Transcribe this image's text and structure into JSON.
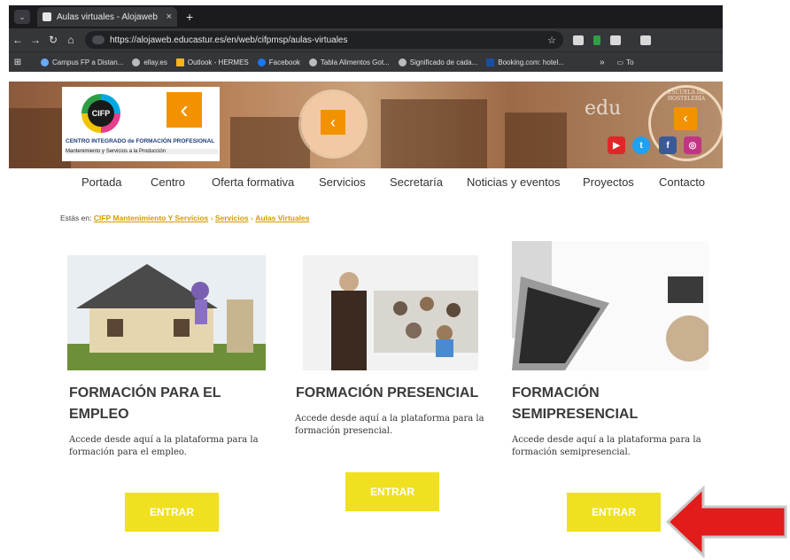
{
  "browser": {
    "tab_title": "Aulas virtuales - Alojaweb",
    "tab_close": "×",
    "new_tab": "+",
    "url": "https://alojaweb.educastur.es/en/web/cifpmsp/aulas-virtuales",
    "bookmarks": [
      "Campus FP a Distan...",
      "ellay.es",
      "Outlook - HERMES",
      "Facebook",
      "Tabla Alimentos Got...",
      "Significado de cada...",
      "Booking.com: hotel..."
    ],
    "bookmarks_more": "»",
    "bookmarks_folder": "To"
  },
  "banner": {
    "logo_name": "CIFP",
    "logo_line1": "CENTRO INTEGRADO de FORMACIÓN PROFESIONAL",
    "logo_line2": "Mantenimiento y Servicios a la Producción",
    "right_text": "edu",
    "seal_text": "ESCUELA DE HOSTELERÍA"
  },
  "nav": {
    "items": [
      "Portada",
      "Centro",
      "Oferta formativa",
      "Servicios",
      "Secretaría",
      "Noticias y eventos",
      "Proyectos",
      "Contacto"
    ]
  },
  "breadcrumb": {
    "prefix": "Estás en:",
    "items": [
      "CIFP Mantenimiento Y Servicios",
      "Servicios",
      "Aulas Virtuales"
    ],
    "separator": "›"
  },
  "cards": [
    {
      "title_line1": "FORMACIÓN PARA EL",
      "title_line2": "EMPLEO",
      "text_line1": "Accede desde aquí a la plataforma para la",
      "text_line2": "formación para el empleo.",
      "button": "ENTRAR"
    },
    {
      "title_line1": "FORMACIÓN PRESENCIAL",
      "title_line2": "",
      "text_line1": "Accede desde aquí a la plataforma para la",
      "text_line2": "formación presencial.",
      "button": "ENTRAR"
    },
    {
      "title_line1": "FORMACIÓN",
      "title_line2": "SEMIPRESENCIAL",
      "text_line1": "Accede desde aquí a la plataforma para la",
      "text_line2": "formación semipresencial.",
      "button": "ENTRAR"
    }
  ],
  "colors": {
    "accent": "#f0e020",
    "arrow": "#e21b1b",
    "brand_orange": "#f39200",
    "link": "#d69a00"
  }
}
